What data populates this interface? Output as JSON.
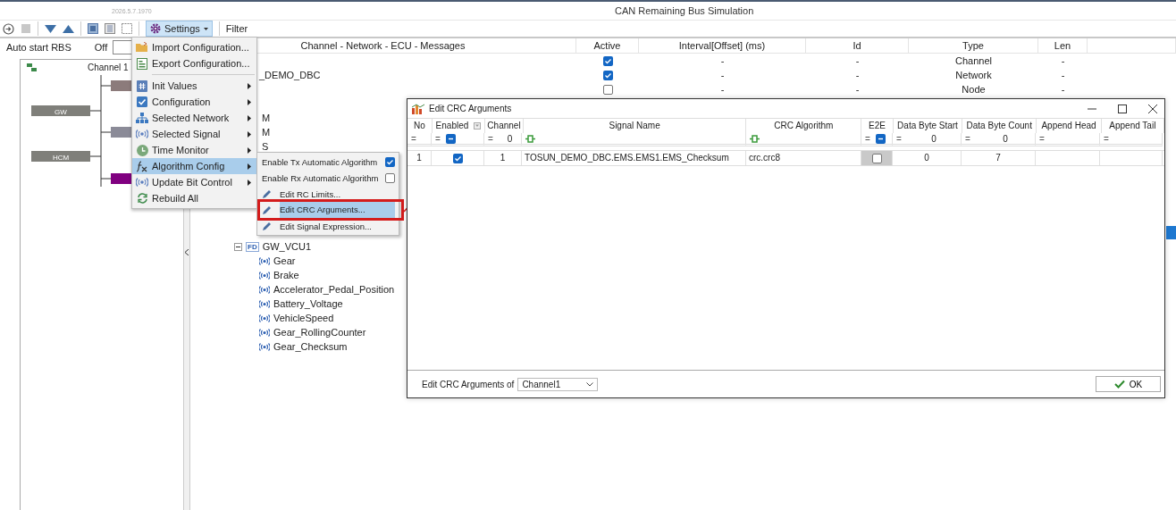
{
  "window": {
    "version": "2026.5.7.1970",
    "title": "CAN Remaining Bus Simulation"
  },
  "toolbar": {
    "settings": "Settings",
    "filter": "Filter"
  },
  "rbs": {
    "auto_start": "Auto start RBS",
    "state": "Off",
    "on": false,
    "channel": "Channel 1",
    "nodes": [
      {
        "label": "GW"
      },
      {
        "label": "HCM"
      }
    ],
    "links": [
      {
        "color": "#8c7b7b"
      },
      {
        "color": "#8b8b98"
      },
      {
        "color": "#800080"
      }
    ]
  },
  "tree": {
    "columns": [
      "Channel - Network - ECU - Messages",
      "Active",
      "Interval[Offset] (ms)",
      "Id",
      "Type",
      "Len"
    ],
    "rows": [
      {
        "active": true,
        "interval": "-",
        "id": "-",
        "type": "Channel",
        "len": "-"
      },
      {
        "label": "_DEMO_DBC",
        "active": true,
        "interval": "-",
        "id": "-",
        "type": "Network",
        "len": "-"
      },
      {
        "active": false,
        "interval": "-",
        "id": "-",
        "type": "Node",
        "len": "-"
      }
    ],
    "fragments": [
      "M",
      "M",
      "S"
    ],
    "message": {
      "label": "GW_VCU1",
      "badge": "FD",
      "expanded": true,
      "children": [
        {
          "label": "Gear"
        },
        {
          "label": "Brake"
        },
        {
          "label": "Accelerator_Pedal_Position"
        },
        {
          "label": "Battery_Voltage"
        },
        {
          "label": "VehicleSpeed"
        },
        {
          "label": "Gear_RollingCounter"
        },
        {
          "label": "Gear_Checksum"
        }
      ]
    }
  },
  "menu": {
    "items": [
      {
        "label": "Import Configuration...",
        "submenu": false,
        "selected": false
      },
      {
        "label": "Export Configuration...",
        "submenu": false,
        "selected": false
      },
      {
        "label": "Init Values",
        "submenu": true,
        "selected": false
      },
      {
        "label": "Configuration",
        "submenu": true,
        "selected": false
      },
      {
        "label": "Selected Network",
        "submenu": true,
        "selected": false
      },
      {
        "label": "Selected Signal",
        "submenu": true,
        "selected": false
      },
      {
        "label": "Time Monitor",
        "submenu": true,
        "selected": false
      },
      {
        "label": "Algorithm Config",
        "submenu": true,
        "selected": true
      },
      {
        "label": "Update Bit Control",
        "submenu": true,
        "selected": false
      },
      {
        "label": "Rebuild All",
        "submenu": false,
        "selected": false
      }
    ]
  },
  "submenu": {
    "items": [
      {
        "kind": "toggle",
        "label": "Enable Tx Automatic Algorithm",
        "checked": true,
        "selected": false,
        "annotated": false
      },
      {
        "kind": "toggle",
        "label": "Enable Rx Automatic Algorithm",
        "checked": false,
        "selected": false,
        "annotated": false
      },
      {
        "kind": "action",
        "label": "Edit RC Limits...",
        "selected": false,
        "annotated": false
      },
      {
        "kind": "action",
        "label": "Edit CRC Arguments...",
        "selected": true,
        "annotated": true
      },
      {
        "kind": "action",
        "label": "Edit Signal Expression...",
        "selected": false,
        "annotated": false
      }
    ]
  },
  "dialog": {
    "title": "Edit CRC Arguments",
    "columns": [
      {
        "label": "No",
        "filter_icon": false,
        "filter": {
          "kind": "text",
          "op": "="
        }
      },
      {
        "label": "Enabled",
        "filter_icon": true,
        "filter": {
          "kind": "check",
          "op": "=",
          "indeterminate": true
        }
      },
      {
        "label": "Channel",
        "filter_icon": false,
        "filter": {
          "kind": "text",
          "op": "=",
          "value": "0"
        }
      },
      {
        "label": "Signal Name",
        "filter_icon": false,
        "filter": {
          "kind": "signal"
        }
      },
      {
        "label": "CRC Algorithm",
        "filter_icon": false,
        "filter": {
          "kind": "signal"
        }
      },
      {
        "label": "E2E",
        "filter_icon": false,
        "filter": {
          "kind": "check",
          "op": "=",
          "indeterminate": true
        }
      },
      {
        "label": "Data Byte Start",
        "filter_icon": false,
        "filter": {
          "kind": "text",
          "op": "=",
          "value": "0"
        }
      },
      {
        "label": "Data Byte Count",
        "filter_icon": false,
        "filter": {
          "kind": "text",
          "op": "=",
          "value": "0"
        }
      },
      {
        "label": "Append Head",
        "filter_icon": false,
        "filter": {
          "kind": "text",
          "op": "="
        }
      },
      {
        "label": "Append Tail",
        "filter_icon": false,
        "filter": {
          "kind": "text",
          "op": "="
        }
      }
    ],
    "rows": [
      {
        "no": "1",
        "enabled": true,
        "channel": "1",
        "signal": "TOSUN_DEMO_DBC.EMS.EMS1.EMS_Checksum",
        "algorithm": "crc.crc8",
        "e2e": false,
        "start": "0",
        "count": "7"
      }
    ],
    "footer_label": "Edit CRC Arguments of",
    "channel": "Channel1",
    "ok": "OK"
  }
}
